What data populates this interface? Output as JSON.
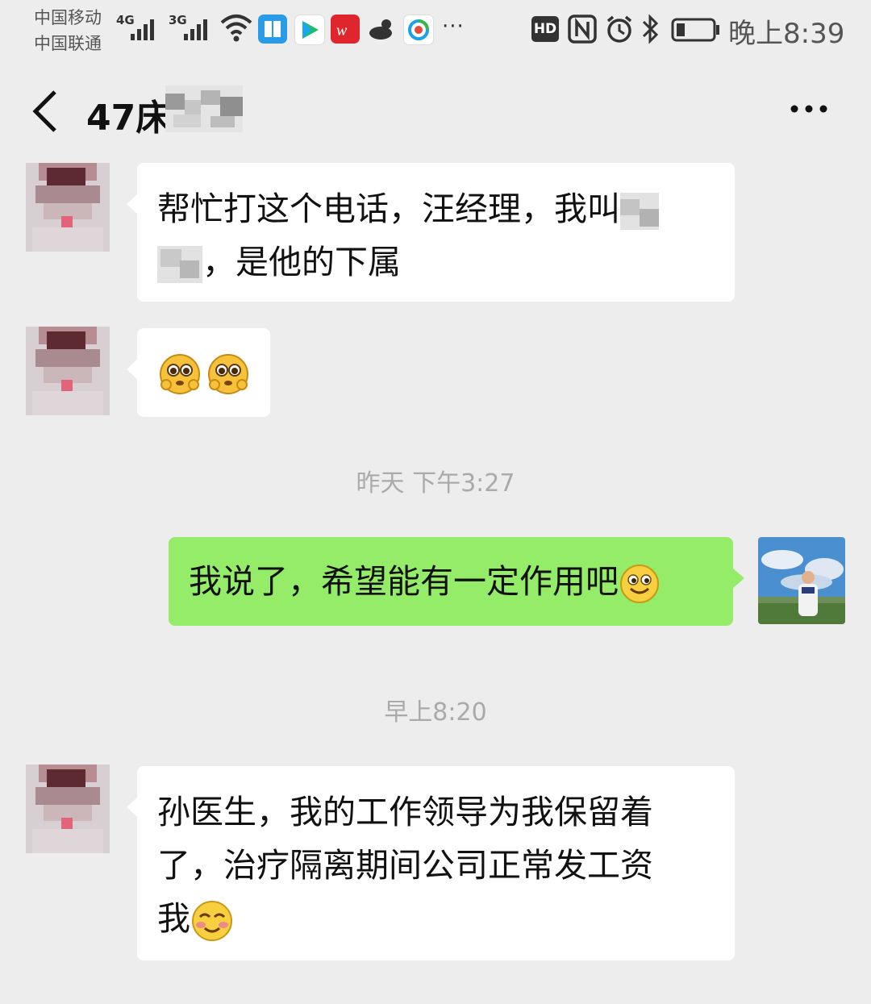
{
  "status_bar": {
    "carrier_1": "中国移动",
    "carrier_2": "中国联通",
    "net_1": "4G",
    "net_2": "3G",
    "hd": "HD",
    "time": "晚上8:39",
    "overflow": "···"
  },
  "chat": {
    "title": "47床"
  },
  "messages": [
    {
      "side": "left",
      "lines": [
        "帮忙打这个电话，汪经理，我叫",
        "，是他的下属"
      ]
    },
    {
      "side": "left",
      "emoji": "pleading-face-emoji"
    },
    {
      "timestamp": "昨天 下午3:27"
    },
    {
      "side": "right",
      "text": "我说了，希望能有一定作用吧"
    },
    {
      "timestamp": "早上8:20"
    },
    {
      "side": "left",
      "lines": [
        "孙医生，我的工作领导为我保留着",
        "了，治疗隔离期间公司正常发工资",
        "我"
      ]
    }
  ],
  "colors": {
    "background": "#ededed",
    "self_bubble": "#95ec69",
    "other_bubble": "#ffffff",
    "timestamp": "#aaaaaa"
  }
}
